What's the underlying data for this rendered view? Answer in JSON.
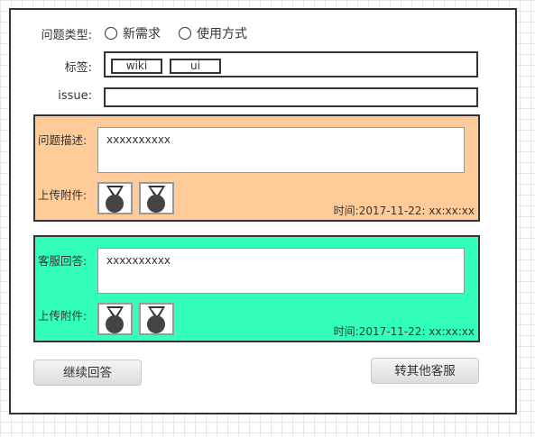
{
  "form": {
    "type_label": "问题类型:",
    "type_options": [
      "新需求",
      "使用方式"
    ],
    "tags_label": "标签:",
    "tags": [
      "wiki",
      "ui"
    ],
    "issue_label": "issue:",
    "issue_value": ""
  },
  "question": {
    "desc_label": "问题描述:",
    "desc_value": "xxxxxxxxxx",
    "attach_label": "上传附件:",
    "time": "时间:2017-11-22: xx:xx:xx",
    "bg_color": "#ffcc99"
  },
  "answer": {
    "desc_label": "客服回答:",
    "desc_value": "xxxxxxxxxx",
    "attach_label": "上传附件:",
    "time": "时间:2017-11-22: xx:xx:xx",
    "bg_color": "#33ffbb"
  },
  "buttons": {
    "continue": "继续回答",
    "transfer": "转其他客服"
  },
  "icons": {
    "attachment": "image-placeholder-icon"
  }
}
